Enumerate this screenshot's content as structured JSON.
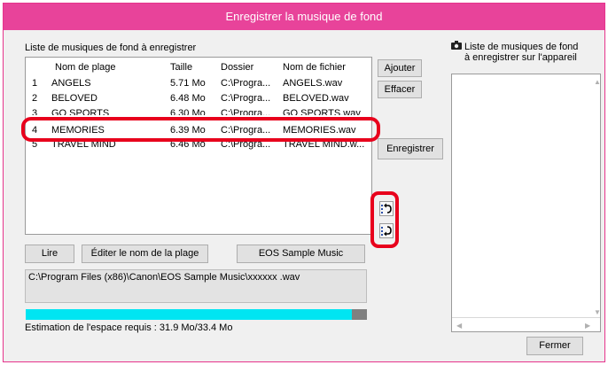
{
  "window": {
    "title": "Enregistrer la musique de fond"
  },
  "left_panel": {
    "section_label": "Liste de musiques de fond à enregistrer",
    "columns": [
      "Nom de plage",
      "Taille",
      "Dossier",
      "Nom de fichier"
    ],
    "rows": [
      {
        "num": "1",
        "name": "ANGELS",
        "size": "5.71 Mo",
        "folder": "C:\\Progra...",
        "file": "ANGELS.wav"
      },
      {
        "num": "2",
        "name": "BELOVED",
        "size": "6.48 Mo",
        "folder": "C:\\Progra...",
        "file": "BELOVED.wav"
      },
      {
        "num": "3",
        "name": "GO SPORTS",
        "size": "6.30 Mo",
        "folder": "C:\\Progra...",
        "file": "GO SPORTS.wav"
      },
      {
        "num": "4",
        "name": "MEMORIES",
        "size": "6.39 Mo",
        "folder": "C:\\Progra...",
        "file": "MEMORIES.wav"
      },
      {
        "num": "5",
        "name": "TRAVEL MIND",
        "size": "6.46 Mo",
        "folder": "C:\\Progra...",
        "file": "TRAVEL MIND.w..."
      }
    ],
    "play_label": "Lire",
    "edit_label": "Éditer le nom de la plage",
    "sample_label": "EOS Sample Music",
    "path": "C:\\Program Files (x86)\\Canon\\EOS Sample Music\\xxxxxx .wav",
    "progress": 0.955,
    "estimate": "Estimation de l'espace requis : 31.9 Mo/33.4 Mo"
  },
  "middle": {
    "add_label": "Ajouter",
    "remove_label": "Effacer",
    "save_label": "Enregistrer"
  },
  "right_panel": {
    "label_line1": "Liste de musiques de fond",
    "label_line2": "à enregistrer sur l'appareil"
  },
  "close_label": "Fermer",
  "colors": {
    "titlebar": "#e8439a",
    "highlight": "#e8001c",
    "progress": "#00e5f2"
  }
}
